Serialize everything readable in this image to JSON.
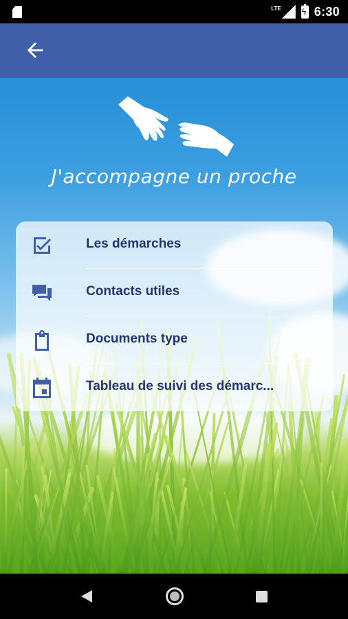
{
  "status_bar": {
    "time": "6:30",
    "network": "LTE"
  },
  "app_bar": {
    "back_icon": "arrow-left-icon"
  },
  "header": {
    "icon": "hands-icon",
    "title": "J'accompagne un proche"
  },
  "menu": {
    "items": [
      {
        "label": "Les démarches",
        "icon": "checkbox-checked-icon"
      },
      {
        "label": "Contacts utiles",
        "icon": "chat-bubbles-icon"
      },
      {
        "label": "Documents type",
        "icon": "clipboard-icon"
      },
      {
        "label": "Tableau de suivi des démarc...",
        "icon": "calendar-icon"
      }
    ]
  },
  "nav_bar": {
    "back": "nav-back-icon",
    "home": "nav-home-icon",
    "recent": "nav-recent-icon"
  },
  "colors": {
    "app_bar": "#3f5fa8",
    "icon_blue": "#3f5fa8",
    "label_text": "#24376b"
  }
}
